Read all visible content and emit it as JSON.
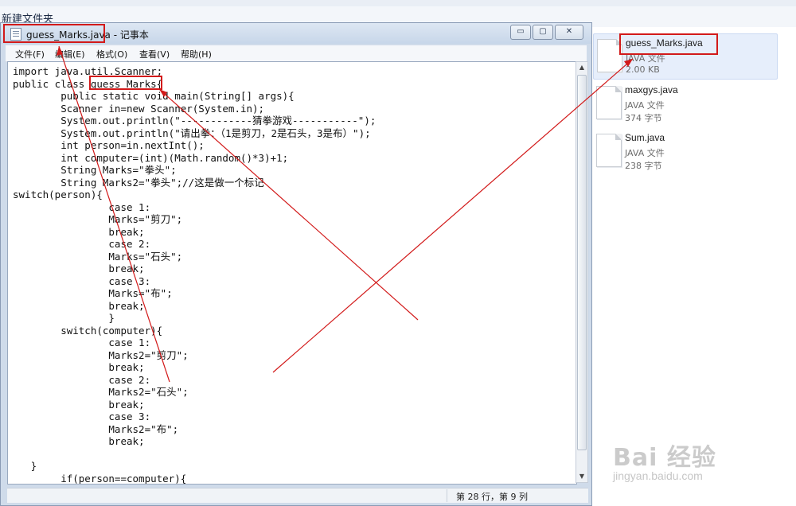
{
  "explorer": {
    "command": "新建文件夹",
    "files": [
      {
        "name": "guess_Marks.java",
        "type": "JAVA 文件",
        "size": "2.00 KB",
        "selected": true
      },
      {
        "name": "maxgys.java",
        "type": "JAVA 文件",
        "size": "374 字节",
        "selected": false
      },
      {
        "name": "Sum.java",
        "type": "JAVA 文件",
        "size": "238 字节",
        "selected": false
      }
    ]
  },
  "notepad": {
    "title_file": "guess_Marks.java",
    "title_app": " - 记事本",
    "buttons": {
      "minimize": "▭",
      "maximize": "▢",
      "close": "✕"
    },
    "menu": [
      "文件(F)",
      "编辑(E)",
      "格式(O)",
      "查看(V)",
      "帮助(H)"
    ],
    "code": "import java.util.Scanner;\npublic class guess_Marks{\n        public static void main(String[] args){\n        Scanner in=new Scanner(System.in);\n        System.out.println(\"------------猜拳游戏-----------\");\n        System.out.println(\"请出拳：（1是剪刀，2是石头，3是布）\");\n        int person=in.nextInt();\n        int computer=(int)(Math.random()*3)+1;\n        String Marks=\"拳头\";\n        String Marks2=\"拳头\";//这是做一个标记\nswitch(person){\n                case 1:\n                Marks=\"剪刀\";\n                break;\n                case 2:\n                Marks=\"石头\";\n                break;\n                case 3:\n                Marks=\"布\";\n                break;\n                }\n        switch(computer){\n                case 1:\n                Marks2=\"剪刀\";\n                break;\n                case 2:\n                Marks2=\"石头\";\n                break;\n                case 3:\n                Marks2=\"布\";\n                break;\n\n   }\n        if(person==computer){",
    "status": "第 28 行，第 9 列"
  },
  "watermark": {
    "brand": "Bai 经验",
    "site": "jingyan.baidu.com"
  },
  "annotation_color": "#d21a1a"
}
